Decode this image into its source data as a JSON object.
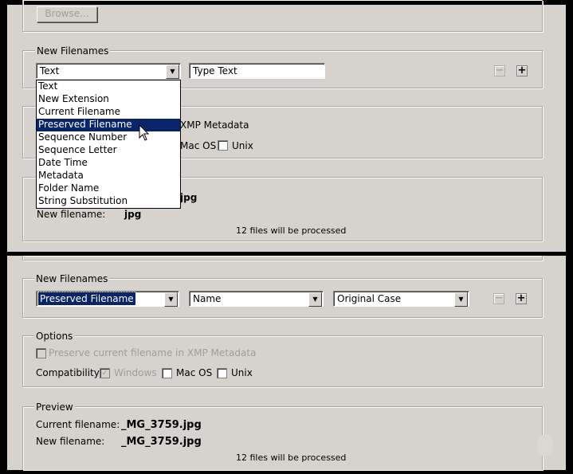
{
  "top": {
    "browse_label": "Browse...",
    "new_filenames_legend": "New Filenames",
    "field1_value": "Text",
    "text_input_value": "Type Text",
    "dropdown_options": [
      "Text",
      "New Extension",
      "Current Filename",
      "Preserved Filename",
      "Sequence Number",
      "Sequence Letter",
      "Date Time",
      "Metadata",
      "Folder Name",
      "String Substitution"
    ],
    "selected_option": "Preserved Filename",
    "options_partial_xmp": "XMP Metadata",
    "options_partial_macos": "Mac OS",
    "options_partial_unix": "Unix",
    "preview_partial_current": "jpg",
    "new_filename_label": "New filename:",
    "new_filename_value": "jpg",
    "files_processed": "12 files will be processed"
  },
  "bottom": {
    "new_filenames_legend": "New Filenames",
    "field1_value": "Preserved Filename",
    "field2_value": "Name",
    "field3_value": "Original Case",
    "options_legend": "Options",
    "preserve_label": "Preserve current filename in XMP Metadata",
    "compat_label": "Compatibility:",
    "windows_label": "Windows",
    "macos_label": "Mac OS",
    "unix_label": "Unix",
    "preview_legend": "Preview",
    "current_filename_label": "Current filename:",
    "current_filename_value": "_MG_3759.jpg",
    "new_filename_label": "New filename:",
    "new_filename_value": "_MG_3759.jpg",
    "files_processed": "12 files will be processed"
  },
  "icons": {
    "minus": "−",
    "plus": "+",
    "check": "✓",
    "arrow": "▼"
  }
}
